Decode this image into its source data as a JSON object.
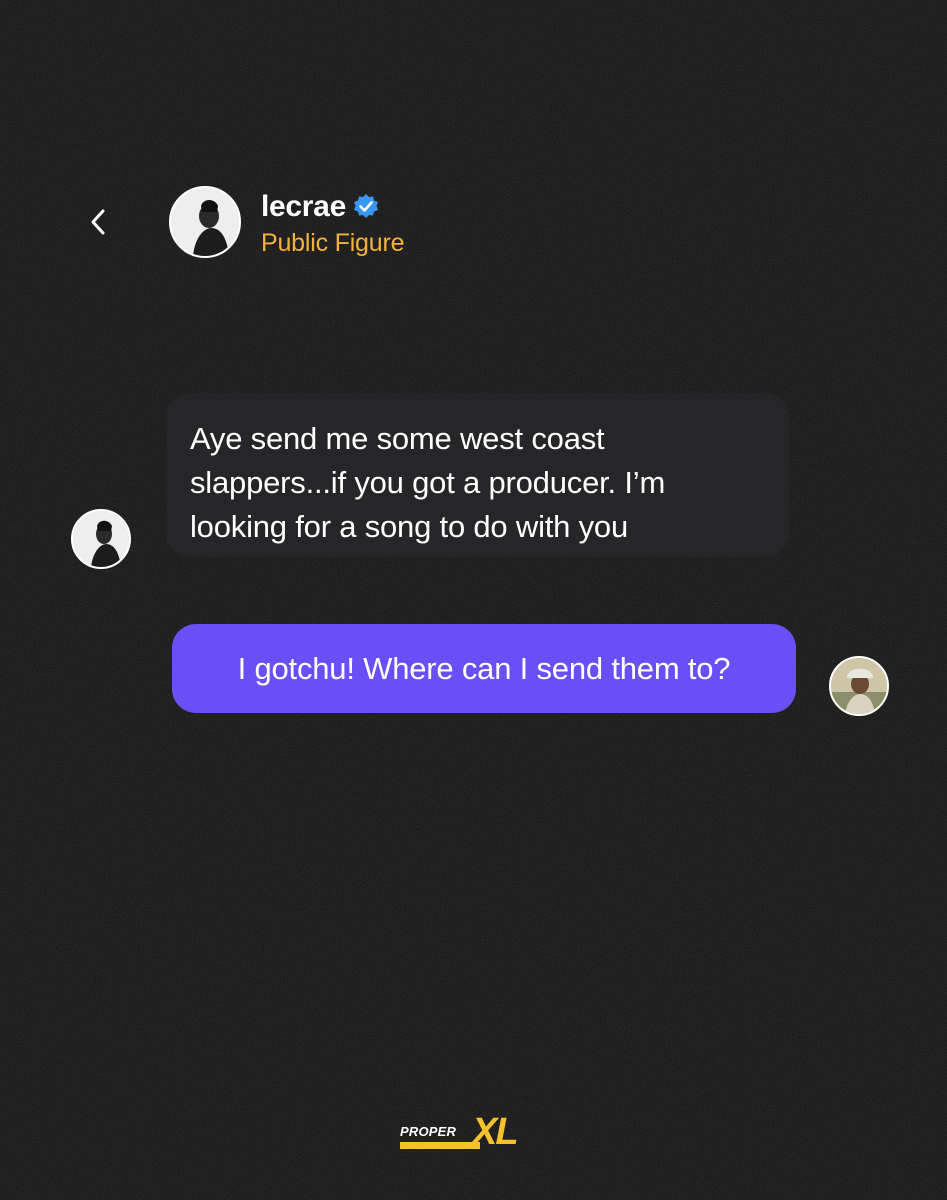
{
  "colors": {
    "background": "#121212",
    "incoming_bubble": "#262628",
    "outgoing_bubble": "#6a4ff7",
    "subtitle": "#f3b23b",
    "verified": "#3797f0",
    "logo_accent": "#f6c22c"
  },
  "header": {
    "back_icon": "chevron-left-icon",
    "name": "lecrae",
    "verified_icon": "verified-badge-icon",
    "subtitle": "Public Figure"
  },
  "messages": [
    {
      "direction": "incoming",
      "text": "Aye send me some west coast slappers...if you got a producer. I’m looking for a song to do with you"
    },
    {
      "direction": "outgoing",
      "text": "I gotchu! Where can I send them to?"
    }
  ],
  "logo": {
    "part1": "PROPER",
    "part2": "XL"
  }
}
